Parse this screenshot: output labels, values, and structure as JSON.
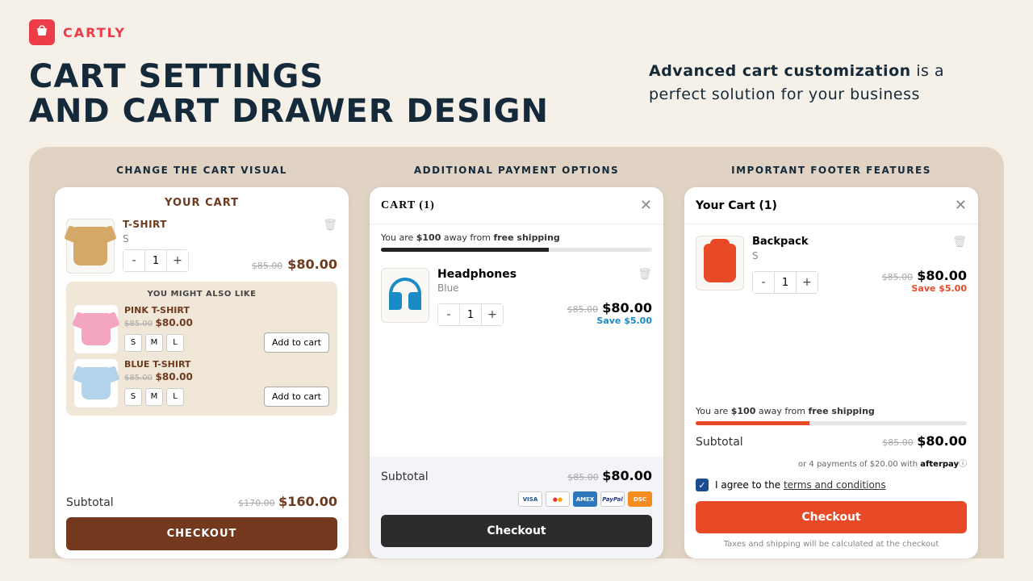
{
  "brand": "CARTLY",
  "hero": {
    "line1": "CART SETTINGS",
    "line2": "AND CART DRAWER DESIGN",
    "right_bold": "Advanced cart customization",
    "right_rest": " is a perfect solution for your business"
  },
  "cols": {
    "c1": "CHANGE THE CART VISUAL",
    "c2": "ADDITIONAL PAYMENT OPTIONS",
    "c3": "IMPORTANT FOOTER FEATURES"
  },
  "c1": {
    "title": "YOUR CART",
    "item": {
      "name": "T-SHIRT",
      "variant": "S",
      "qty": "1",
      "old": "$85.00",
      "price": "$80.00"
    },
    "recs_title": "YOU MIGHT ALSO LIKE",
    "recs": [
      {
        "name": "PINK T-SHIRT",
        "old": "$85.00",
        "price": "$80.00"
      },
      {
        "name": "BLUE T-SHIRT",
        "old": "$85.00",
        "price": "$80.00"
      }
    ],
    "sizes": [
      "S",
      "M",
      "L"
    ],
    "add": "Add to cart",
    "subtotal": "Subtotal",
    "sub_old": "$170.00",
    "sub_price": "$160.00",
    "checkout": "CHECKOUT"
  },
  "c2": {
    "title": "CART (1)",
    "ship_pre": "You are ",
    "ship_amt": "$100",
    "ship_mid": " away from ",
    "ship_end": "free shipping",
    "item": {
      "name": "Headphones",
      "variant": "Blue",
      "qty": "1",
      "old": "$85.00",
      "price": "$80.00",
      "save": "Save $5.00"
    },
    "subtotal": "Subtotal",
    "sub_old": "$85.00",
    "sub_price": "$80.00",
    "checkout": "Checkout"
  },
  "c3": {
    "title": "Your Cart (1)",
    "item": {
      "name": "Backpack",
      "variant": "S",
      "qty": "1",
      "old": "$85.00",
      "price": "$80.00",
      "save": "Save $5.00"
    },
    "ship_pre": "You are ",
    "ship_amt": "$100",
    "ship_mid": " away from ",
    "ship_end": "free shipping",
    "subtotal": "Subtotal",
    "sub_old": "$85.00",
    "sub_price": "$80.00",
    "afterpay": "or 4 payments of $20.00 with",
    "afterpay_brand": "afterpay",
    "agree_pre": "I agree to the ",
    "agree_link": "terms and conditions",
    "checkout": "Checkout",
    "tax": "Taxes and shipping will be calculated at the checkout"
  }
}
